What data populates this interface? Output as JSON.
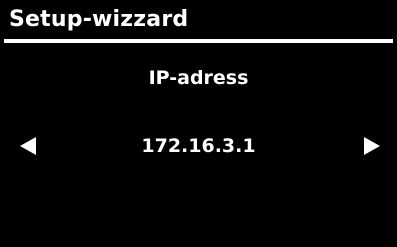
{
  "header": {
    "title": "Setup-wizzard"
  },
  "field": {
    "label": "IP-adress",
    "value": "172.16.3.1"
  },
  "controls": {
    "prev_icon": "triangle-left-icon",
    "next_icon": "triangle-right-icon"
  },
  "colors": {
    "background": "#000000",
    "foreground": "#ffffff"
  }
}
